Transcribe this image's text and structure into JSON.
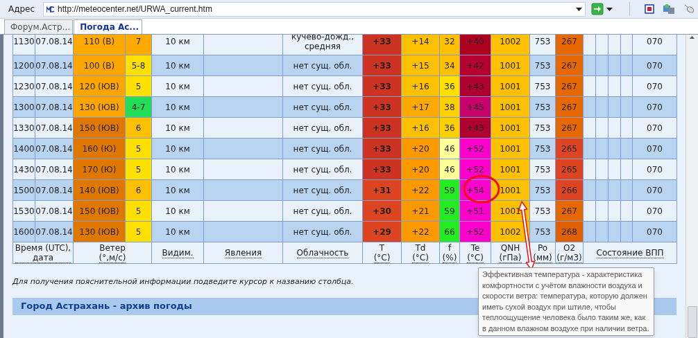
{
  "address_bar": {
    "label": "Адрес",
    "url": "http://meteocenter.net/URWA_current.htm"
  },
  "tabs": [
    {
      "label": "Форум.Астр...",
      "selected": false
    },
    {
      "label": "Погода Ас...",
      "selected": true
    }
  ],
  "table": {
    "rows": [
      {
        "time": "1130",
        "date": "07.08.14",
        "wind_direction": {
          "text": "110 (В)",
          "color": "#ffaa00"
        },
        "wind_speed": {
          "text": "7",
          "color": "#ffaa00"
        },
        "visibility": "10 км",
        "clouds": "кучево-дожд., средняя",
        "t": {
          "text": "+33",
          "color": "#cc3322"
        },
        "td": {
          "text": "+14",
          "color": "#ffc000"
        },
        "f": {
          "text": "32",
          "color": "#ffc000"
        },
        "te": {
          "text": "+40",
          "color": "#b00020"
        },
        "qnh": {
          "text": "1002",
          "color": "#ffc000"
        },
        "po": "753",
        "o2": {
          "text": "267",
          "color": "#e86800"
        },
        "runway": "070"
      },
      {
        "time": "1200",
        "date": "07.08.14",
        "wind_direction": {
          "text": "100 (В)",
          "color": "#ffa500"
        },
        "wind_speed": {
          "text": "5-8",
          "color": "#ffe000"
        },
        "visibility": "10 км",
        "clouds": "нет сущ. обл.",
        "t": {
          "text": "+33",
          "color": "#cc3322"
        },
        "td": {
          "text": "+15",
          "color": "#ffc000"
        },
        "f": {
          "text": "34",
          "color": "#ffc000"
        },
        "te": {
          "text": "+42",
          "color": "#b80030"
        },
        "qnh": {
          "text": "1001",
          "color": "#ffc000"
        },
        "po": "753",
        "o2": {
          "text": "267",
          "color": "#e86800"
        },
        "runway": "070"
      },
      {
        "time": "1230",
        "date": "07.08.14",
        "wind_direction": {
          "text": "120 (ЮВ)",
          "color": "#ffa500"
        },
        "wind_speed": {
          "text": "5",
          "color": "#ffe000"
        },
        "visibility": "10 км",
        "clouds": "нет сущ. обл.",
        "t": {
          "text": "+33",
          "color": "#cc3322"
        },
        "td": {
          "text": "+16",
          "color": "#ffc000"
        },
        "f": {
          "text": "36",
          "color": "#ffe000"
        },
        "te": {
          "text": "+43",
          "color": "#b00030"
        },
        "qnh": {
          "text": "1001",
          "color": "#ffc000"
        },
        "po": "753",
        "o2": {
          "text": "267",
          "color": "#e86800"
        },
        "runway": "070"
      },
      {
        "time": "1300",
        "date": "07.08.14",
        "wind_direction": {
          "text": "130 (ЮВ)",
          "color": "#ffa500"
        },
        "wind_speed": {
          "text": "4-7",
          "color": "#22dd55"
        },
        "visibility": "10 км",
        "clouds": "нет сущ. обл.",
        "t": {
          "text": "+33",
          "color": "#cc3322"
        },
        "td": {
          "text": "+17",
          "color": "#ffaa00"
        },
        "f": {
          "text": "38",
          "color": "#ffd000"
        },
        "te": {
          "text": "+45",
          "color": "#c8006a"
        },
        "qnh": {
          "text": "1001",
          "color": "#ffc000"
        },
        "po": "753",
        "o2": {
          "text": "267",
          "color": "#e86800"
        },
        "runway": "070"
      },
      {
        "time": "1330",
        "date": "07.08.14",
        "wind_direction": {
          "text": "150 (ЮВ)",
          "color": "#e07800"
        },
        "wind_speed": {
          "text": "6",
          "color": "#ffc000"
        },
        "visibility": "10 км",
        "clouds": "нет сущ. обл.",
        "t": {
          "text": "+33",
          "color": "#cc3322"
        },
        "td": {
          "text": "+16",
          "color": "#ffc000"
        },
        "f": {
          "text": "36",
          "color": "#ffd000"
        },
        "te": {
          "text": "+43",
          "color": "#b00030"
        },
        "qnh": {
          "text": "1001",
          "color": "#ffc000"
        },
        "po": "753",
        "o2": {
          "text": "267",
          "color": "#e86800"
        },
        "runway": "070"
      },
      {
        "time": "1400",
        "date": "07.08.14",
        "wind_direction": {
          "text": "160 (Ю)",
          "color": "#e07800"
        },
        "wind_speed": {
          "text": "5",
          "color": "#ffe000"
        },
        "visibility": "10 км",
        "clouds": "нет сущ. обл.",
        "t": {
          "text": "+33",
          "color": "#cc3322"
        },
        "td": {
          "text": "+20",
          "color": "#ff9900"
        },
        "f": {
          "text": "46",
          "color": "#ffff99"
        },
        "te": {
          "text": "+52",
          "color": "#ff00cc"
        },
        "qnh": {
          "text": "1001",
          "color": "#ffc000"
        },
        "po": "753",
        "o2": {
          "text": "265",
          "color": "#dd4422"
        },
        "runway": "070"
      },
      {
        "time": "1430",
        "date": "07.08.14",
        "wind_direction": {
          "text": "170 (Ю)",
          "color": "#e07800"
        },
        "wind_speed": {
          "text": "5",
          "color": "#ffe000"
        },
        "visibility": "10 км",
        "clouds": "нет сущ. обл.",
        "t": {
          "text": "+33",
          "color": "#cc3322"
        },
        "td": {
          "text": "+20",
          "color": "#ff9900"
        },
        "f": {
          "text": "46",
          "color": "#ffff99"
        },
        "te": {
          "text": "+52",
          "color": "#ff00cc"
        },
        "qnh": {
          "text": "1001",
          "color": "#ffc000"
        },
        "po": "753",
        "o2": {
          "text": "265",
          "color": "#dd4422"
        },
        "runway": "070"
      },
      {
        "time": "1500",
        "date": "07.08.14",
        "wind_direction": {
          "text": "140 (ЮВ)",
          "color": "#e07800"
        },
        "wind_speed": {
          "text": "6",
          "color": "#ffc000"
        },
        "visibility": "10 км",
        "clouds": "нет сущ. обл.",
        "t": {
          "text": "+31",
          "color": "#dd4422"
        },
        "td": {
          "text": "+22",
          "color": "#ff9900"
        },
        "f": {
          "text": "59",
          "color": "#22ee22"
        },
        "te": {
          "text": "+54",
          "color": "#ff00cc"
        },
        "qnh": {
          "text": "1001",
          "color": "#ffc000"
        },
        "po": "753",
        "o2": {
          "text": "266",
          "color": "#dd4422"
        },
        "runway": "070"
      },
      {
        "time": "1530",
        "date": "07.08.14",
        "wind_direction": {
          "text": "150 (ЮВ)",
          "color": "#e07800"
        },
        "wind_speed": {
          "text": "5",
          "color": "#ffe000"
        },
        "visibility": "10 км",
        "clouds": "нет сущ. обл.",
        "t": {
          "text": "+30",
          "color": "#dd4422"
        },
        "td": {
          "text": "+21",
          "color": "#ff9900"
        },
        "f": {
          "text": "59",
          "color": "#22ee22"
        },
        "te": {
          "text": "+51",
          "color": "#ff00cc"
        },
        "qnh": {
          "text": "1001",
          "color": "#ffc000"
        },
        "po": "753",
        "o2": {
          "text": "267",
          "color": "#e86800"
        },
        "runway": "070"
      },
      {
        "time": "1600",
        "date": "07.08.14",
        "wind_direction": {
          "text": "130 (ЮВ)",
          "color": "#e07800"
        },
        "wind_speed": {
          "text": "5",
          "color": "#ffe000"
        },
        "visibility": "10 км",
        "clouds": "нет сущ. обл.",
        "t": {
          "text": "+29",
          "color": "#dd4422"
        },
        "td": {
          "text": "+22",
          "color": "#ff9900"
        },
        "f": {
          "text": "66",
          "color": "#22ee22"
        },
        "te": {
          "text": "+52",
          "color": "#ff00cc"
        },
        "qnh": {
          "text": "1002",
          "color": "#ffc000"
        },
        "po": "753",
        "o2": {
          "text": "268",
          "color": "#e06000"
        },
        "runway": "070"
      }
    ],
    "headers": [
      {
        "label": "Время (UTC),",
        "sub": "дата"
      },
      {
        "label": "Ветер",
        "sub": "(°,м/с)"
      },
      {
        "label": "Видим."
      },
      {
        "label": "Явления"
      },
      {
        "label": "Облачность"
      },
      {
        "label": "T",
        "sub": "(°C)"
      },
      {
        "label": "Td",
        "sub": "(°C)"
      },
      {
        "label": "f",
        "sub": "(%)"
      },
      {
        "label": "Te",
        "sub": "(°C)"
      },
      {
        "label": "QNH",
        "sub": "(гПа)"
      },
      {
        "label": "Po",
        "sub": "(мм)"
      },
      {
        "label": "O2",
        "sub": "(г/м3)"
      },
      {
        "label": "Состояние ВПП"
      }
    ]
  },
  "hint": "Для получения пояснительной информации подведите курсор к названию столбца.",
  "section_title": "Город Астрахань - архив погоды",
  "tooltip": "Эффективная температура - характеристика комфортности с учётом влажности воздуха и скорости ветра: температура, которую должен иметь сухой воздух при штиле, чтобы теплоощущение человека было таким же, как в данном влажном воздухе при наличии ветра."
}
